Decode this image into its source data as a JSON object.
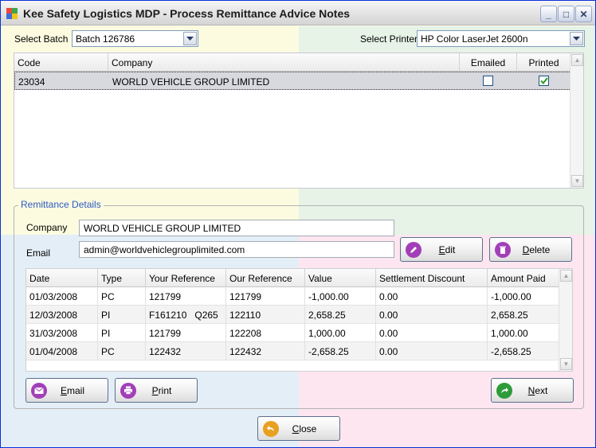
{
  "window": {
    "title": "Kee Safety Logistics MDP - Process Remittance Advice Notes",
    "min_glyph": "_",
    "max_glyph": "□",
    "close_glyph": "✕"
  },
  "batch": {
    "label": "Select Batch",
    "value": "Batch 126786"
  },
  "printer": {
    "label": "Select Printer",
    "value": "HP Color LaserJet 2600n"
  },
  "companies_grid": {
    "headers": {
      "code": "Code",
      "company": "Company",
      "emailed": "Emailed",
      "printed": "Printed"
    },
    "rows": [
      {
        "code": "23034",
        "company": "WORLD VEHICLE GROUP LIMITED",
        "emailed": false,
        "printed": true
      }
    ]
  },
  "details": {
    "group_title": "Remittance Details",
    "company_label": "Company",
    "company_value": "WORLD VEHICLE GROUP LIMITED",
    "email_label": "Email",
    "email_value": "admin@worldvehiclegrouplimited.com",
    "edit_label_u": "E",
    "edit_label_rest": "dit",
    "delete_label_u": "D",
    "delete_label_rest": "elete"
  },
  "remit_grid": {
    "headers": {
      "date": "Date",
      "type": "Type",
      "your_ref": "Your Reference",
      "our_ref": "Our Reference",
      "value": "Value",
      "settlement": "Settlement Discount",
      "amount_paid": "Amount Paid"
    },
    "rows": [
      {
        "date": "01/03/2008",
        "type": "PC",
        "your_ref": "121799",
        "our_ref": "121799",
        "value": "-1,000.00",
        "settlement": "0.00",
        "amount_paid": "-1,000.00"
      },
      {
        "date": "12/03/2008",
        "type": "PI",
        "your_ref": "F161210   Q265",
        "our_ref": "122110",
        "value": "2,658.25",
        "settlement": "0.00",
        "amount_paid": "2,658.25"
      },
      {
        "date": "31/03/2008",
        "type": "PI",
        "your_ref": "121799",
        "our_ref": "122208",
        "value": "1,000.00",
        "settlement": "0.00",
        "amount_paid": "1,000.00"
      },
      {
        "date": "01/04/2008",
        "type": "PC",
        "your_ref": "122432",
        "our_ref": "122432",
        "value": "-2,658.25",
        "settlement": "0.00",
        "amount_paid": "-2,658.25"
      }
    ]
  },
  "buttons": {
    "email_u": "E",
    "email_rest": "mail",
    "print_u": "P",
    "print_rest": "rint",
    "next_u": "N",
    "next_rest": "ext",
    "close_u": "C",
    "close_rest": "lose"
  },
  "colors": {
    "accent_purple": "#a23fb8",
    "next_green": "#2e9b3a",
    "close_orange": "#e8a020",
    "selected_row": "#d8d8df",
    "group_title": "#2f59c4"
  }
}
